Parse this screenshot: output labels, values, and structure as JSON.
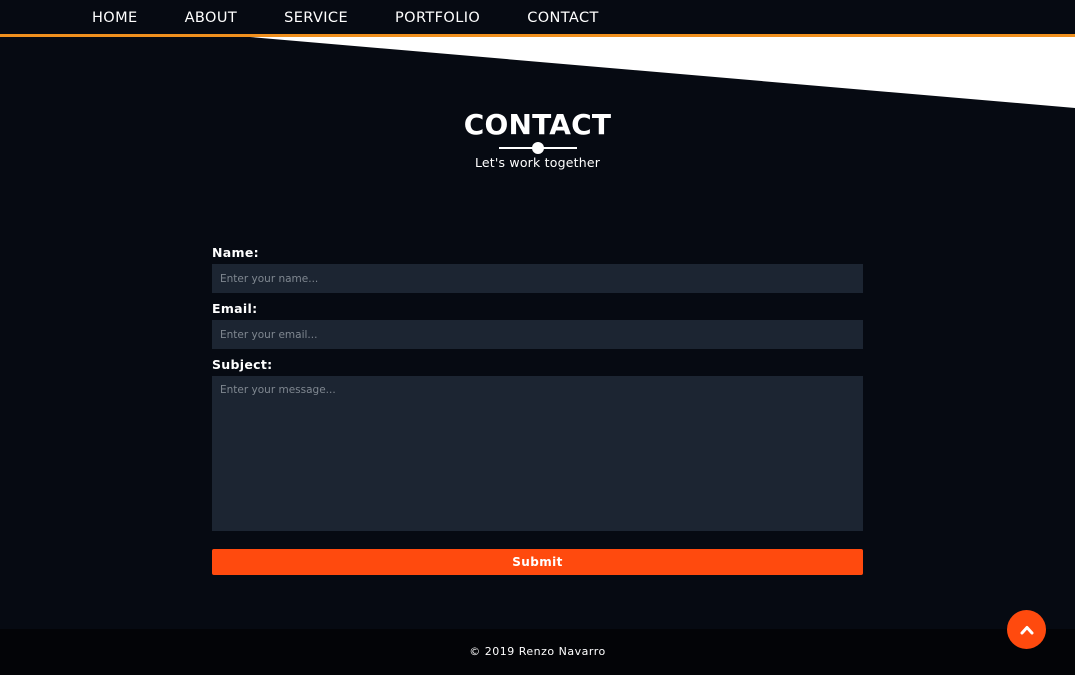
{
  "nav": {
    "items": [
      {
        "label": "HOME"
      },
      {
        "label": "ABOUT"
      },
      {
        "label": "SERVICE"
      },
      {
        "label": "PORTFOLIO"
      },
      {
        "label": "CONTACT"
      }
    ]
  },
  "section": {
    "title": "CONTACT",
    "subtitle": "Let's work together"
  },
  "form": {
    "name_label": "Name:",
    "name_placeholder": "Enter your name...",
    "email_label": "Email:",
    "email_placeholder": "Enter your email...",
    "subject_label": "Subject:",
    "subject_placeholder": "Enter your message...",
    "submit_label": "Submit"
  },
  "footer": {
    "copyright": "© 2019 Renzo Navarro"
  },
  "icons": {
    "scroll_top": "chevron-up-icon"
  },
  "colors": {
    "background": "#060a12",
    "nav_accent": "#f0901e",
    "field_bg": "#1c2532",
    "button": "#ff4a0e",
    "footer_bg": "#030407"
  }
}
